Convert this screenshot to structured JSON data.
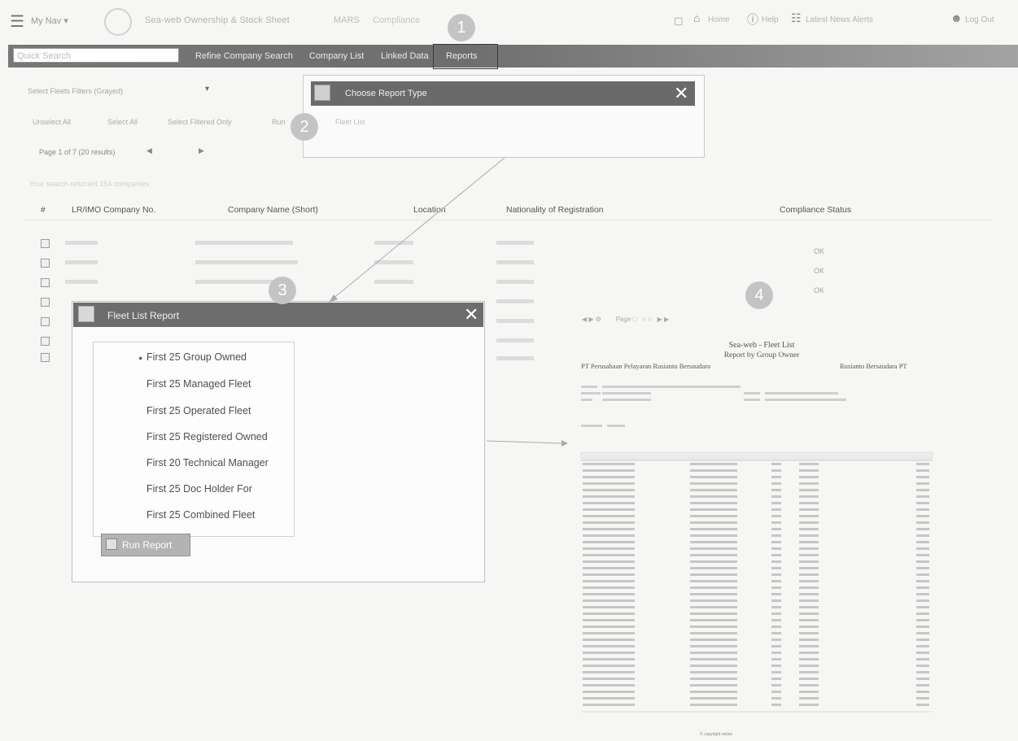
{
  "header": {
    "menu_icon": "hamburger-icon",
    "my_nav": "My Nav ▾",
    "app_title": "Sea-web Ownership & Stock Sheet",
    "fragment_1": "MARS",
    "fragment_2": "Compliance",
    "right_links": [
      "Home",
      "Help",
      "Latest News Alerts",
      "Log Out"
    ]
  },
  "navbar": {
    "search_placeholder": "Quick Search",
    "items": [
      "Refine Company Search",
      "Company List",
      "Linked Data",
      "Reports"
    ]
  },
  "badges": [
    "1",
    "2",
    "3",
    "4"
  ],
  "list": {
    "select_fleet": "Select Fleets Filters (Grayed)",
    "filters": [
      "Unselect All",
      "Select All",
      "Select Filtered Only",
      "Run"
    ],
    "pager": "Page 1 of 7 (20 results)",
    "search_info": "Your search returned 154 companies",
    "columns": [
      "#",
      "LR/IMO Company No.",
      "Company Name (Short)",
      "Location",
      "Nationality of Registration",
      "Compliance Status"
    ],
    "compliance": [
      "OK",
      "OK",
      "OK"
    ]
  },
  "choose_dialog": {
    "title": "Choose Report Type",
    "item": "Fleet List"
  },
  "fleet_dialog": {
    "title": "Fleet List Report",
    "options": [
      "First 25 Group Owned",
      "First 25 Managed Fleet",
      "First 25 Operated Fleet",
      "First 25 Registered Owned",
      "First 20 Technical Manager",
      "First 25 Doc Holder For",
      "First 25 Combined Fleet"
    ],
    "selected_index": 0,
    "run_label": "Run Report"
  },
  "report": {
    "title": "Sea-web - Fleet List",
    "subtitle": "Report by Group Owner",
    "company_left": "PT Perusahaan Pelayaran Rusianto Bersaudara",
    "company_right": "Rusianto Bersaudara PT"
  },
  "colors": {
    "navbar": "#777777",
    "dialog_header": "#6a6a6a",
    "badge": "#c4c4c4",
    "run_button": "#b3b3b3"
  }
}
